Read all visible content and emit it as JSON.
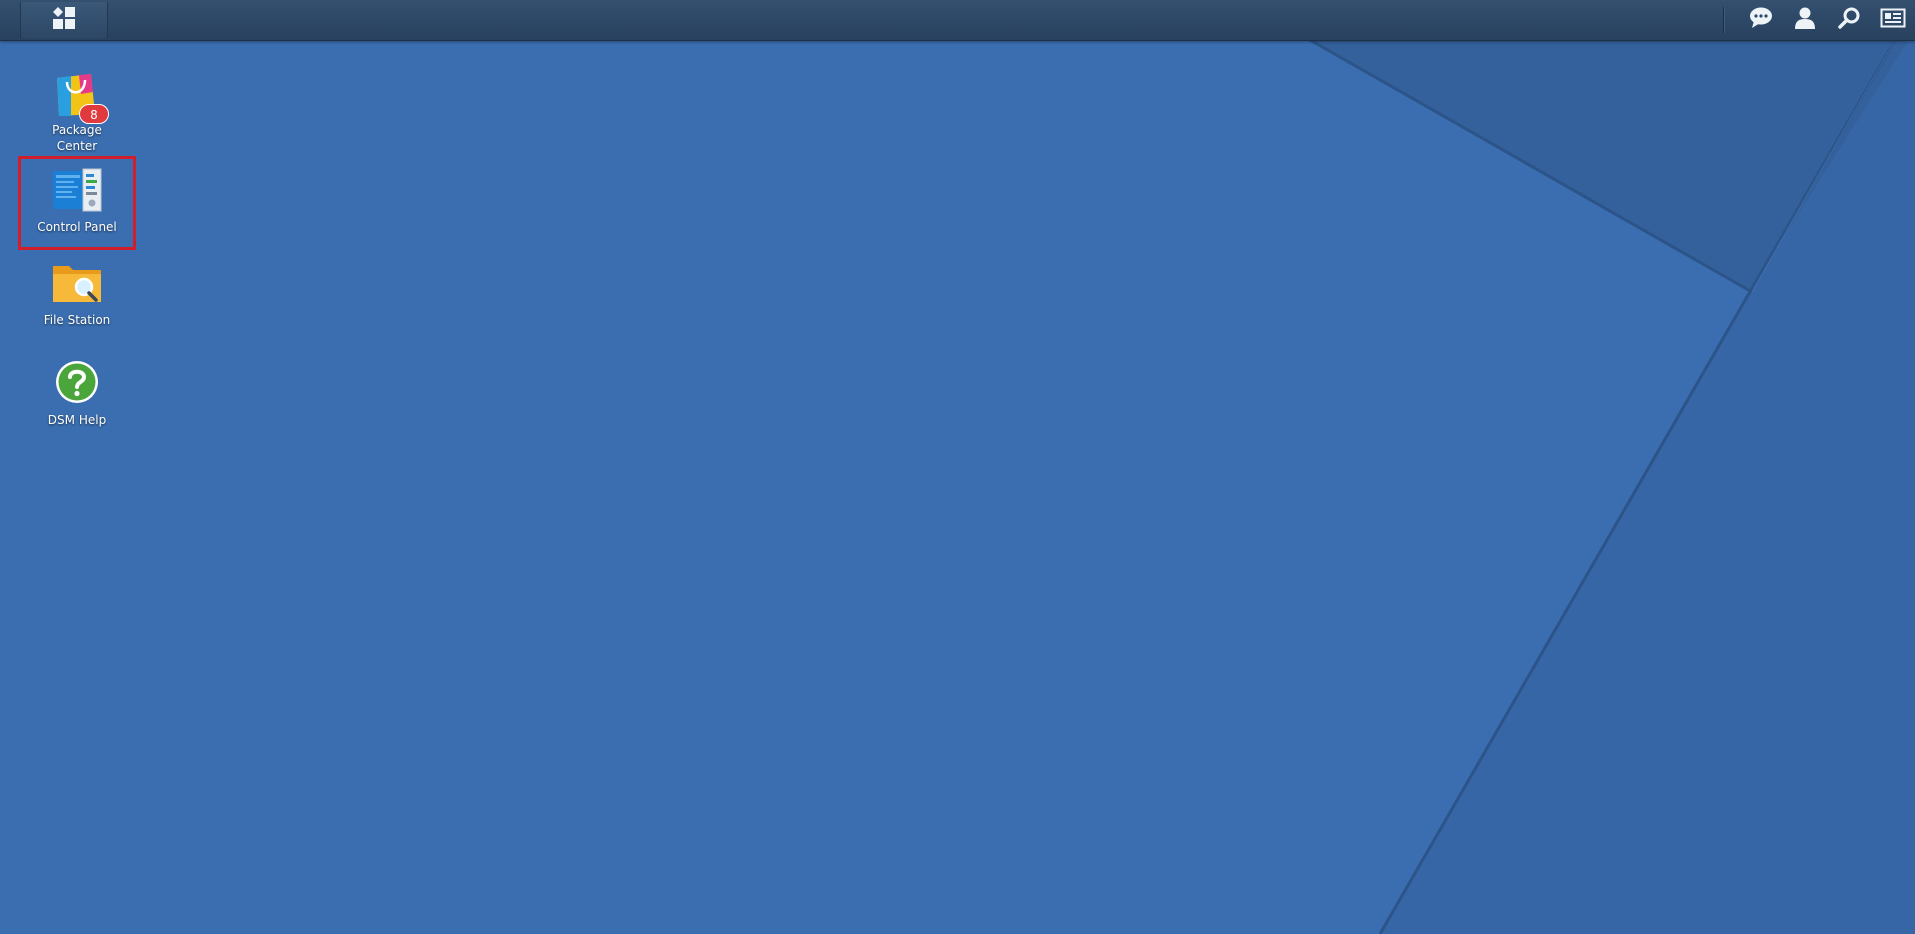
{
  "taskbar": {
    "main_menu_icon": "apps-grid-icon",
    "tray": [
      {
        "name": "notifications",
        "icon": "chat-bubble-icon"
      },
      {
        "name": "user-options",
        "icon": "user-icon"
      },
      {
        "name": "search",
        "icon": "search-icon"
      },
      {
        "name": "widgets",
        "icon": "widgets-icon"
      }
    ]
  },
  "desktop": {
    "icons": [
      {
        "label": "Package\nCenter",
        "icon": "package-center-icon",
        "badge": "8",
        "selected": false
      },
      {
        "label": "Control Panel",
        "icon": "control-panel-icon",
        "badge": null,
        "selected": true
      },
      {
        "label": "File Station",
        "icon": "file-station-icon",
        "badge": null,
        "selected": false
      },
      {
        "label": "DSM Help",
        "icon": "help-icon",
        "badge": null,
        "selected": false
      }
    ]
  },
  "colors": {
    "wallpaper": "#3a6eb0",
    "taskbar": "#2d4766",
    "selection_border": "#d21d2a",
    "badge": "#e0393e"
  }
}
